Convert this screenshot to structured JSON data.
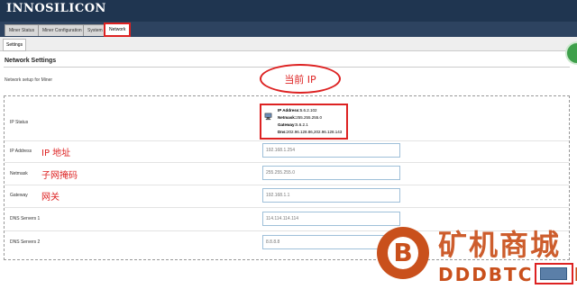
{
  "app": {
    "logo": "INNOSILICON"
  },
  "tabs": [
    {
      "label": "Miner Status"
    },
    {
      "label": "Miner Configuration"
    },
    {
      "label": "System"
    },
    {
      "label": "Network"
    }
  ],
  "subtabs": [
    {
      "label": "Settings"
    }
  ],
  "section": {
    "title": "Network Settings",
    "description": "Network setup for Miner"
  },
  "callout": {
    "text": "当前 IP"
  },
  "ip_status": {
    "label": "IP Status",
    "address_label": "IP Address:",
    "address": "5.6.2.102",
    "netmask_label": "Netmask:",
    "netmask": "255.255.255.0",
    "gateway_label": "Gateway:",
    "gateway": "5.6.2.1",
    "dns_label": "Dns:",
    "dns": "202.96.128.86,202.96.128.143"
  },
  "fields": {
    "ip_address": {
      "label": "IP Address",
      "annotation": "IP 地址",
      "placeholder": "192.168.1.254"
    },
    "netmask": {
      "label": "Netmask",
      "annotation": "子网掩码",
      "placeholder": "255.255.255.0"
    },
    "gateway": {
      "label": "Gateway",
      "annotation": "网关",
      "placeholder": "192.168.1.1"
    },
    "dns1": {
      "label": "DNS Servers 1",
      "placeholder": "114.114.114.114"
    },
    "dns2": {
      "label": "DNS Servers 2",
      "placeholder": "8.8.8.8"
    }
  },
  "watermark": {
    "glyph": "B",
    "cn": "矿机商城",
    "en": "DDDBTC.COM"
  },
  "colors": {
    "accent": "#dd2222",
    "topbar": "#1f3550",
    "watermark": "#c9501c"
  }
}
